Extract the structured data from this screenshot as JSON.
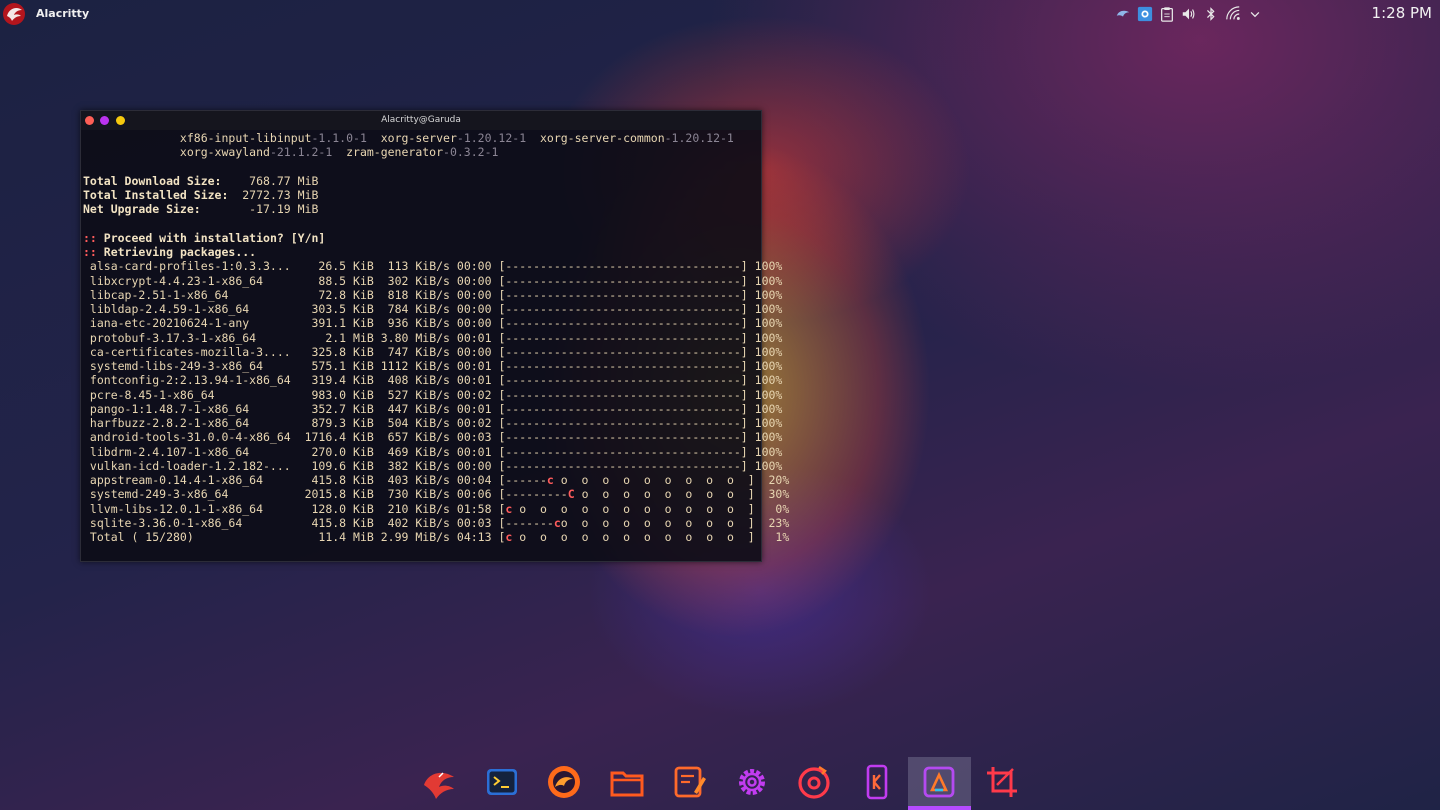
{
  "panel": {
    "active_app": "Alacritty",
    "clock": "1:28 PM",
    "tray_icons": [
      "garuda-boot-options-icon",
      "screen-capture-icon",
      "clipboard-icon",
      "volume-icon",
      "bluetooth-icon",
      "wifi-icon",
      "chevron-down-icon"
    ]
  },
  "terminal": {
    "title": "Alacritty@Garuda",
    "pkg_lines": [
      [
        {
          "t": "              xf86-input-libinput"
        },
        {
          "t": "-1.1.0-1",
          "c": "dim"
        },
        {
          "t": "  xorg-server"
        },
        {
          "t": "-1.20.12-1",
          "c": "dim"
        },
        {
          "t": "  xorg-server-common"
        },
        {
          "t": "-1.20.12-1",
          "c": "dim"
        }
      ],
      [
        {
          "t": "              xorg-xwayland"
        },
        {
          "t": "-21.1.2-1",
          "c": "dim"
        },
        {
          "t": "  zram-generator"
        },
        {
          "t": "-0.3.2-1",
          "c": "dim"
        }
      ]
    ],
    "summary": [
      {
        "label": "Total Download Size:",
        "value": "    768.77 MiB"
      },
      {
        "label": "Total Installed Size:",
        "value": "  2772.73 MiB"
      },
      {
        "label": "Net Upgrade Size:",
        "value": "       -17.19 MiB"
      }
    ],
    "prompt": "Proceed with installation? [Y/n]",
    "retrieving": "Retrieving packages...",
    "downloads": [
      {
        "name": "alsa-card-profiles-1:0.3.3...",
        "size": "26.5 KiB",
        "rate": "113 KiB/s",
        "time": "00:00",
        "pre": "[----------------------------------",
        "mark": "",
        "post": "]",
        "pct": "100%"
      },
      {
        "name": "libxcrypt-4.4.23-1-x86_64",
        "size": "88.5 KiB",
        "rate": "302 KiB/s",
        "time": "00:00",
        "pre": "[----------------------------------",
        "mark": "",
        "post": "]",
        "pct": "100%"
      },
      {
        "name": "libcap-2.51-1-x86_64",
        "size": "72.8 KiB",
        "rate": "818 KiB/s",
        "time": "00:00",
        "pre": "[----------------------------------",
        "mark": "",
        "post": "]",
        "pct": "100%"
      },
      {
        "name": "libldap-2.4.59-1-x86_64",
        "size": "303.5 KiB",
        "rate": "784 KiB/s",
        "time": "00:00",
        "pre": "[----------------------------------",
        "mark": "",
        "post": "]",
        "pct": "100%"
      },
      {
        "name": "iana-etc-20210624-1-any",
        "size": "391.1 KiB",
        "rate": "936 KiB/s",
        "time": "00:00",
        "pre": "[----------------------------------",
        "mark": "",
        "post": "]",
        "pct": "100%"
      },
      {
        "name": "protobuf-3.17.3-1-x86_64",
        "size": "2.1 MiB",
        "rate": "3.80 MiB/s",
        "time": "00:01",
        "pre": "[----------------------------------",
        "mark": "",
        "post": "]",
        "pct": "100%"
      },
      {
        "name": "ca-certificates-mozilla-3....",
        "size": "325.8 KiB",
        "rate": "747 KiB/s",
        "time": "00:00",
        "pre": "[----------------------------------",
        "mark": "",
        "post": "]",
        "pct": "100%"
      },
      {
        "name": "systemd-libs-249-3-x86_64",
        "size": "575.1 KiB",
        "rate": "1112 KiB/s",
        "time": "00:01",
        "pre": "[----------------------------------",
        "mark": "",
        "post": "]",
        "pct": "100%"
      },
      {
        "name": "fontconfig-2:2.13.94-1-x86_64",
        "size": "319.4 KiB",
        "rate": "408 KiB/s",
        "time": "00:01",
        "pre": "[----------------------------------",
        "mark": "",
        "post": "]",
        "pct": "100%"
      },
      {
        "name": "pcre-8.45-1-x86_64",
        "size": "983.0 KiB",
        "rate": "527 KiB/s",
        "time": "00:02",
        "pre": "[----------------------------------",
        "mark": "",
        "post": "]",
        "pct": "100%"
      },
      {
        "name": "pango-1:1.48.7-1-x86_64",
        "size": "352.7 KiB",
        "rate": "447 KiB/s",
        "time": "00:01",
        "pre": "[----------------------------------",
        "mark": "",
        "post": "]",
        "pct": "100%"
      },
      {
        "name": "harfbuzz-2.8.2-1-x86_64",
        "size": "879.3 KiB",
        "rate": "504 KiB/s",
        "time": "00:02",
        "pre": "[----------------------------------",
        "mark": "",
        "post": "]",
        "pct": "100%"
      },
      {
        "name": "android-tools-31.0.0-4-x86_64",
        "size": "1716.4 KiB",
        "rate": "657 KiB/s",
        "time": "00:03",
        "pre": "[----------------------------------",
        "mark": "",
        "post": "]",
        "pct": "100%"
      },
      {
        "name": "libdrm-2.4.107-1-x86_64",
        "size": "270.0 KiB",
        "rate": "469 KiB/s",
        "time": "00:01",
        "pre": "[----------------------------------",
        "mark": "",
        "post": "]",
        "pct": "100%"
      },
      {
        "name": "vulkan-icd-loader-1.2.182-...",
        "size": "109.6 KiB",
        "rate": "382 KiB/s",
        "time": "00:00",
        "pre": "[----------------------------------",
        "mark": "",
        "post": "]",
        "pct": "100%"
      },
      {
        "name": "appstream-0.14.4-1-x86_64",
        "size": "415.8 KiB",
        "rate": "403 KiB/s",
        "time": "00:04",
        "pre": "[------",
        "mark": "c",
        "post": " o  o  o  o  o  o  o  o  o  ]",
        "pct": "20%"
      },
      {
        "name": "systemd-249-3-x86_64",
        "size": "2015.8 KiB",
        "rate": "730 KiB/s",
        "time": "00:06",
        "pre": "[---------",
        "mark": "C",
        "post": " o  o  o  o  o  o  o  o  ]",
        "pct": "30%"
      },
      {
        "name": "llvm-libs-12.0.1-1-x86_64",
        "size": "128.0 KiB",
        "rate": "210 KiB/s",
        "time": "01:58",
        "pre": "[",
        "mark": "c",
        "post": " o  o  o  o  o  o  o  o  o  o  o  ]",
        "pct": "0%"
      },
      {
        "name": "sqlite-3.36.0-1-x86_64",
        "size": "415.8 KiB",
        "rate": "402 KiB/s",
        "time": "00:03",
        "pre": "[-------",
        "mark": "c",
        "post": "o  o  o  o  o  o  o  o  o  ]",
        "pct": "23%"
      },
      {
        "name": "Total ( 15/280)",
        "size": "11.4 MiB",
        "rate": "2.99 MiB/s",
        "time": "04:13",
        "pre": "[",
        "mark": "c",
        "post": " o  o  o  o  o  o  o  o  o  o  o  ]",
        "pct": "1%"
      }
    ]
  },
  "dock": {
    "active_index": 8,
    "apps": [
      {
        "icon": "garuda-welcome-icon"
      },
      {
        "icon": "terminal-icon"
      },
      {
        "icon": "firedragon-browser-icon"
      },
      {
        "icon": "file-manager-icon"
      },
      {
        "icon": "text-editor-icon"
      },
      {
        "icon": "settings-gear-icon"
      },
      {
        "icon": "music-player-icon"
      },
      {
        "icon": "kde-connect-icon"
      },
      {
        "icon": "garuda-assistant-icon"
      },
      {
        "icon": "screenshot-crop-icon"
      }
    ]
  }
}
